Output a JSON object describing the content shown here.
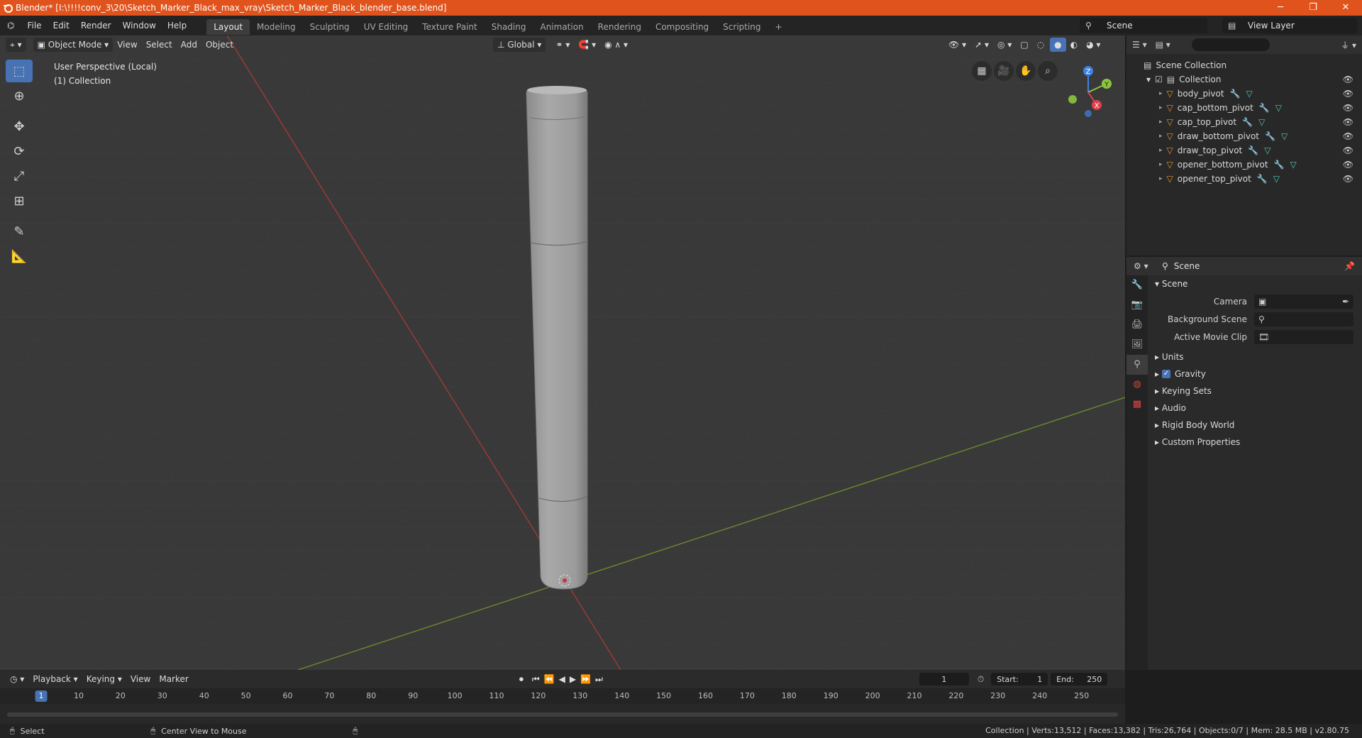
{
  "window": {
    "title": "Blender* [I:\\!!!!conv_3\\20\\Sketch_Marker_Black_max_vray\\Sketch_Marker_Black_blender_base.blend]",
    "minimize": "─",
    "maximize": "❐",
    "close": "✕"
  },
  "menu": [
    "File",
    "Edit",
    "Render",
    "Window",
    "Help"
  ],
  "workspaces": [
    "Layout",
    "Modeling",
    "Sculpting",
    "UV Editing",
    "Texture Paint",
    "Shading",
    "Animation",
    "Rendering",
    "Compositing",
    "Scripting"
  ],
  "workspace_add": "+",
  "scene_name": "Scene",
  "view_layer": "View Layer",
  "viewport": {
    "mode": "Object Mode",
    "menus": [
      "View",
      "Select",
      "Add",
      "Object"
    ],
    "orientation": "Global",
    "info_line1": "User Perspective (Local)",
    "info_line2": "(1) Collection"
  },
  "gizmo": {
    "x": "X",
    "y": "Y",
    "z": "Z"
  },
  "outliner": {
    "root": "Scene Collection",
    "collection": "Collection",
    "objects": [
      "body_pivot",
      "cap_bottom_pivot",
      "cap_top_pivot",
      "draw_bottom_pivot",
      "draw_top_pivot",
      "opener_bottom_pivot",
      "opener_top_pivot"
    ]
  },
  "properties": {
    "header": "Scene",
    "panel": "Scene",
    "camera_label": "Camera",
    "background_label": "Background Scene",
    "movieclip_label": "Active Movie Clip",
    "subpanels": [
      "Units",
      "Gravity",
      "Keying Sets",
      "Audio",
      "Rigid Body World",
      "Custom Properties"
    ]
  },
  "timeline": {
    "menus": [
      "Playback",
      "Keying",
      "View",
      "Marker"
    ],
    "current_frame": "1",
    "start_label": "Start:",
    "start": "1",
    "end_label": "End:",
    "end": "250",
    "ticks": [
      "10",
      "20",
      "30",
      "40",
      "50",
      "60",
      "70",
      "80",
      "90",
      "100",
      "110",
      "120",
      "130",
      "140",
      "150",
      "160",
      "170",
      "180",
      "190",
      "200",
      "210",
      "220",
      "230",
      "240",
      "250"
    ]
  },
  "status": {
    "left1": "Select",
    "left2": "Center View to Mouse",
    "right": "Collection | Verts:13,512 | Faces:13,382 | Tris:26,764 | Objects:0/7 | Mem: 28.5 MB | v2.80.75"
  },
  "colors": {
    "titlebar": "#e0531c",
    "accent": "#4772b3",
    "object_icon": "#e8922e",
    "x_axis": "#e0404e",
    "y_axis": "#8cc63f",
    "z_axis": "#3e83e0"
  }
}
